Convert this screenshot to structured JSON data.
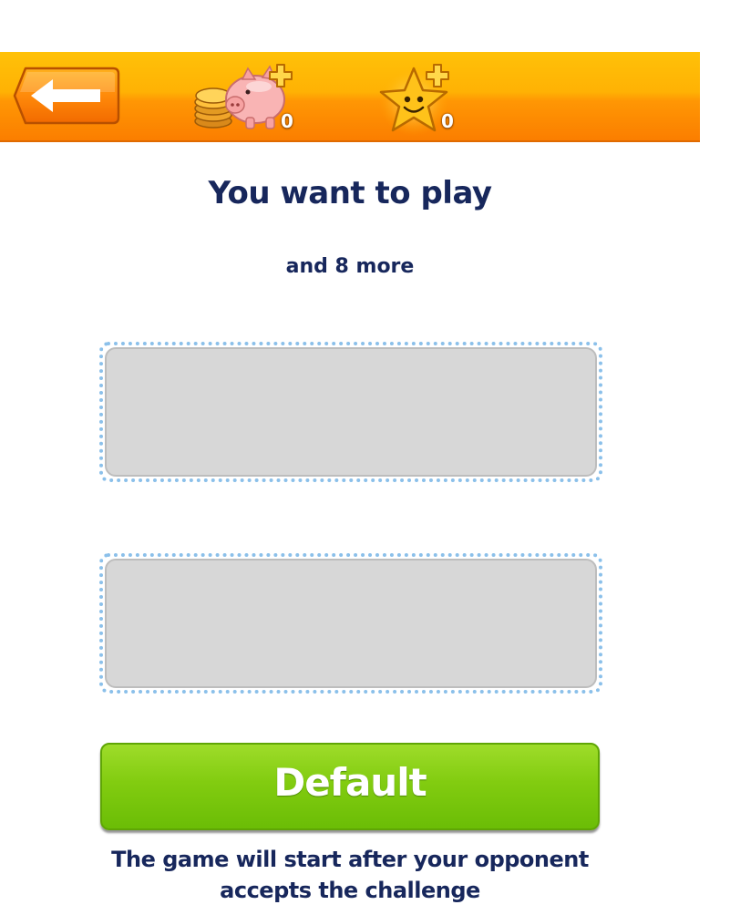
{
  "header": {
    "back_icon": "left-arrow-icon",
    "coins": {
      "icon": "piggy-bank-plus-icon",
      "value": "0"
    },
    "stars": {
      "icon": "smiling-star-plus-icon",
      "value": "0"
    },
    "colors": {
      "bar_top": "#ffc108",
      "bar_bottom": "#fb7e00"
    }
  },
  "main": {
    "headline": "You want to play",
    "subline": "and 8 more",
    "slots": [
      {
        "label": ""
      },
      {
        "label": ""
      }
    ],
    "default_button_label": "Default",
    "footnote": "The game will start after your opponent accepts the challenge"
  },
  "colors": {
    "text": "#17275c",
    "button_green": "#82cc10",
    "slot_border": "#8bc0ea",
    "slot_fill": "#d7d7d7"
  }
}
